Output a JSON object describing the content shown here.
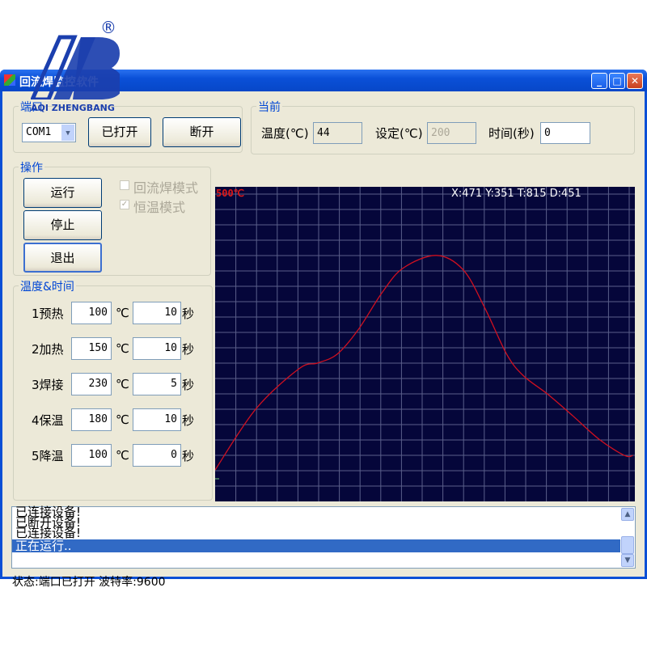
{
  "logo": {
    "text": "ZB",
    "tagline": "AQI ZHENGBANG",
    "registered": "®",
    "color": "#1b3fae"
  },
  "window": {
    "title": "回流焊监控软件",
    "minimize": "_",
    "maximize": "□",
    "close": "✕"
  },
  "port_group": {
    "label": "端口",
    "port": "COM1",
    "open_button": "已打开",
    "disconnect_button": "断开"
  },
  "current_group": {
    "label": "当前",
    "temp_label": "温度(℃)",
    "temp_value": "44",
    "set_label": "设定(℃)",
    "set_value": "200",
    "time_label": "时间(秒)",
    "time_value": "0"
  },
  "ops_group": {
    "label": "操作",
    "run": "运行",
    "stop": "停止",
    "exit": "退出",
    "reflow_mode": "回流焊模式",
    "reflow_checked": false,
    "constant_mode": "恒温模式",
    "constant_checked": true
  },
  "profile_group": {
    "label": "温度&时间",
    "unit_temp": "℃",
    "unit_time": "秒",
    "rows": [
      {
        "name": "1预热",
        "temp": "100",
        "time": "10"
      },
      {
        "name": "2加热",
        "temp": "150",
        "time": "10"
      },
      {
        "name": "3焊接",
        "temp": "230",
        "time": "5"
      },
      {
        "name": "4保温",
        "temp": "180",
        "time": "10"
      },
      {
        "name": "5降温",
        "temp": "100",
        "time": "0"
      }
    ]
  },
  "chart_data": {
    "type": "line",
    "max_label": "500℃",
    "readout": "X:471 Y:351 T:815 D:451",
    "ylim": [
      0,
      500
    ],
    "xlim": [
      0,
      20.3
    ],
    "grid": true,
    "line_color": "#d01020",
    "background": "#05063a",
    "x": [
      0,
      1.97,
      4.06,
      4.96,
      5.9,
      6.9,
      8.1,
      9.1,
      10.7,
      12.0,
      13.05,
      14.1,
      14.9,
      16.1,
      17.3,
      18.6,
      19.8,
      20.2
    ],
    "y": [
      50,
      147,
      211,
      220,
      234,
      272,
      333,
      371,
      391,
      368,
      307,
      234,
      200,
      170,
      136,
      98,
      73,
      73
    ]
  },
  "log": {
    "lines": [
      "已连接设备!",
      "已断开设备!",
      "已连接设备!"
    ],
    "selected": "正在运行.."
  },
  "status": "状态:端口已打开 波特率:9600"
}
